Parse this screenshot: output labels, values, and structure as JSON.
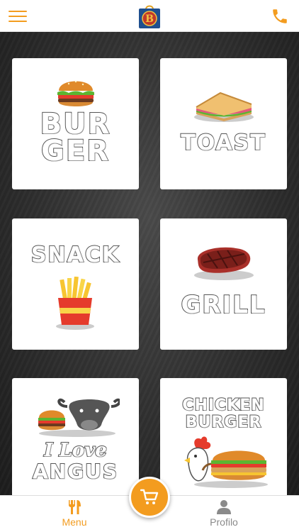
{
  "header": {
    "menu_icon": "hamburger-menu-icon",
    "logo_letter": "B",
    "call_icon": "phone-icon"
  },
  "categories": [
    {
      "line1": "BUR",
      "line2": "GER",
      "icon": "burger-icon"
    },
    {
      "line1": "TOAST",
      "icon": "sandwich-icon"
    },
    {
      "line1": "SNACK",
      "icon": "fries-icon"
    },
    {
      "line1": "GRILL",
      "icon": "steak-icon"
    },
    {
      "line1": "I Love",
      "line2": "ANGUS",
      "icon": "buffalo-burger-icon"
    },
    {
      "line1": "CHICKEN",
      "line2": "BURGER",
      "icon": "rooster-burger-icon"
    }
  ],
  "bottom_nav": {
    "menu_label": "Menu",
    "profile_label": "Profilo",
    "active": "Menu"
  },
  "cart": {
    "icon": "cart-icon"
  },
  "colors": {
    "accent": "#f39c1f",
    "inactive": "#8a8a8a",
    "background": "#2e2e2e"
  }
}
